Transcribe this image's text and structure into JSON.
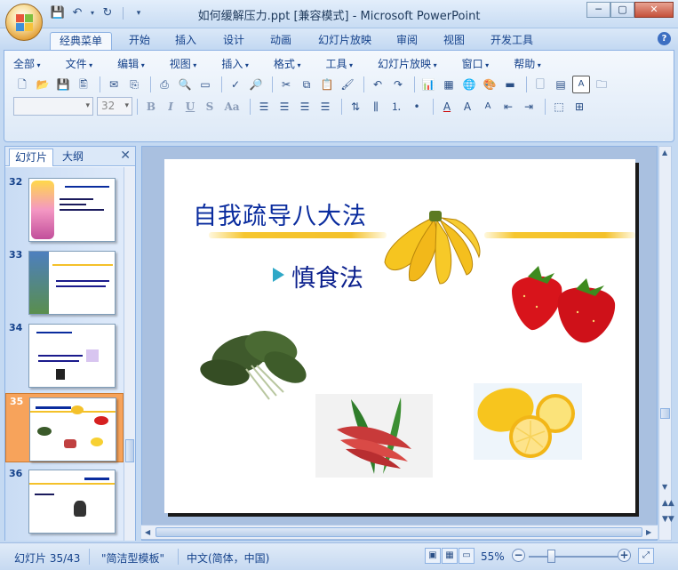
{
  "window": {
    "title": "如何缓解压力.ppt [兼容模式] - Microsoft PowerPoint",
    "controls": [
      "─",
      "▢",
      "✕"
    ]
  },
  "ribbon_tabs": [
    "经典菜单",
    "开始",
    "插入",
    "设计",
    "动画",
    "幻灯片放映",
    "审阅",
    "视图",
    "开发工具"
  ],
  "menus": [
    "全部",
    "文件",
    "编辑",
    "视图",
    "插入",
    "格式",
    "工具",
    "幻灯片放映",
    "窗口",
    "帮助"
  ],
  "font": {
    "name": "",
    "size": "32"
  },
  "format_buttons": [
    "B",
    "I",
    "U",
    "S",
    "Aa"
  ],
  "pane": {
    "tabs": [
      "幻灯片",
      "大纲"
    ],
    "close": "✕",
    "thumbs": [
      {
        "num": "32"
      },
      {
        "num": "33"
      },
      {
        "num": "34"
      },
      {
        "num": "35"
      },
      {
        "num": "36"
      }
    ]
  },
  "slide": {
    "title": "自我疏导八大法",
    "bullet": "慎食法"
  },
  "status": {
    "slide_info": "幻灯片 35/43",
    "template": "\"简洁型模板\"",
    "language": "中文(简体，中国)",
    "zoom": "55%"
  }
}
